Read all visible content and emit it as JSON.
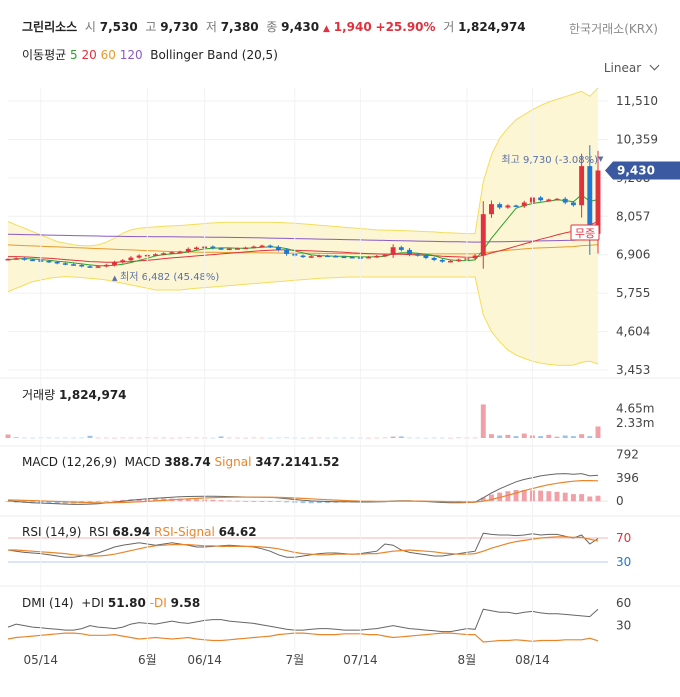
{
  "header": {
    "name": "그린리소스",
    "open_label": "시",
    "open": "7,530",
    "high_label": "고",
    "high": "9,730",
    "low_label": "저",
    "low": "7,380",
    "close_label": "종",
    "close": "9,430",
    "change_arrow": "▲",
    "change": "1,940",
    "change_pct": "+25.90%",
    "volume_label": "거",
    "volume": "1,824,974"
  },
  "exchange": "한국거래소(KRX)",
  "scale_mode": "Linear",
  "indicators": {
    "ma_label": "이동평균",
    "ma_periods": [
      "5",
      "20",
      "60",
      "120"
    ],
    "ma_colors": [
      "#2ca02c",
      "#e0313d",
      "#e89a2c",
      "#8a5ac8"
    ],
    "bollinger": "Bollinger Band (20,5)"
  },
  "colors": {
    "up": "#e0313d",
    "down": "#1f78d1",
    "band": "#f3dd5a",
    "macd": "#666666",
    "signal": "#e8862c",
    "current": "#3a59a0"
  },
  "chart_data": [
    {
      "type": "candlestick",
      "panel": "price",
      "yticks": [
        "11,510",
        "10,359",
        "9,208",
        "8,057",
        "6,906",
        "5,755",
        "4,604",
        "3,453"
      ],
      "ytick_values": [
        11510,
        10359,
        9208,
        8057,
        6906,
        5755,
        4604,
        3453
      ],
      "ylim": [
        3453,
        11900
      ],
      "x_ticks": [
        "05/14",
        "6월",
        "06/14",
        "7월",
        "07/14",
        "8월",
        "08/14"
      ],
      "x_tick_index": [
        4,
        17,
        24,
        35,
        43,
        56,
        64
      ],
      "current_price": "9,430",
      "current_value": 9430,
      "high_annotation": "최고 9,730 (-3.08%)",
      "high_value": 9730,
      "low_annotation": "최저 6,482 (45.48%)",
      "low_value": 6482,
      "event_badge": "무증",
      "close_values": [
        6780,
        6800,
        6760,
        6740,
        6720,
        6690,
        6650,
        6620,
        6600,
        6560,
        6540,
        6560,
        6600,
        6680,
        6740,
        6820,
        6880,
        6900,
        6920,
        6950,
        6980,
        7000,
        7080,
        7120,
        7150,
        7100,
        7080,
        7090,
        7100,
        7120,
        7150,
        7180,
        7140,
        7050,
        6930,
        6880,
        6840,
        6860,
        6880,
        6870,
        6850,
        6840,
        6830,
        6820,
        6840,
        6870,
        6900,
        7130,
        7050,
        6920,
        6880,
        6810,
        6750,
        6700,
        6720,
        6760,
        6800,
        6880,
        8120,
        8420,
        8320,
        8380,
        8360,
        8470,
        8620,
        8540,
        8560,
        8580,
        8470,
        8390,
        9560,
        7530,
        9430
      ],
      "ma5": [
        6760,
        6780,
        6790,
        6780,
        6760,
        6740,
        6710,
        6690,
        6660,
        6630,
        6600,
        6580,
        6570,
        6590,
        6620,
        6670,
        6740,
        6800,
        6870,
        6910,
        6930,
        6950,
        6990,
        7040,
        7080,
        7100,
        7110,
        7110,
        7100,
        7100,
        7110,
        7130,
        7140,
        7130,
        7090,
        7020,
        6960,
        6900,
        6880,
        6870,
        6860,
        6860,
        6850,
        6840,
        6840,
        6840,
        6860,
        6930,
        6960,
        6970,
        6950,
        6920,
        6880,
        6800,
        6750,
        6730,
        6730,
        6750,
        7050,
        7400,
        7700,
        8000,
        8300,
        8380,
        8440,
        8480,
        8510,
        8550,
        8530,
        8490,
        8700,
        8500,
        8560
      ],
      "ma20": [
        6850,
        6850,
        6840,
        6830,
        6810,
        6800,
        6780,
        6760,
        6740,
        6720,
        6700,
        6690,
        6680,
        6680,
        6690,
        6700,
        6720,
        6740,
        6760,
        6790,
        6810,
        6830,
        6850,
        6870,
        6890,
        6910,
        6930,
        6950,
        6970,
        6990,
        7010,
        7030,
        7040,
        7050,
        7050,
        7040,
        7030,
        7020,
        7010,
        7000,
        6990,
        6980,
        6960,
        6950,
        6940,
        6930,
        6920,
        6920,
        6920,
        6910,
        6900,
        6890,
        6880,
        6860,
        6850,
        6840,
        6830,
        6830,
        6890,
        6960,
        7020,
        7090,
        7160,
        7230,
        7300,
        7370,
        7430,
        7500,
        7560,
        7610,
        7760,
        7800,
        7900
      ],
      "ma60": [
        7200,
        7190,
        7180,
        7170,
        7160,
        7150,
        7140,
        7130,
        7120,
        7110,
        7100,
        7090,
        7080,
        7070,
        7060,
        7050,
        7040,
        7030,
        7020,
        7010,
        7000,
        6995,
        6990,
        6985,
        6980,
        6978,
        6975,
        6972,
        6970,
        6968,
        6965,
        6962,
        6960,
        6958,
        6955,
        6952,
        6950,
        6948,
        6946,
        6944,
        6942,
        6940,
        6938,
        6936,
        6934,
        6932,
        6930,
        6930,
        6930,
        6930,
        6930,
        6930,
        6930,
        6930,
        6930,
        6930,
        6930,
        6930,
        6960,
        6990,
        7020,
        7040,
        7060,
        7080,
        7100,
        7110,
        7120,
        7130,
        7140,
        7150,
        7180,
        7190,
        7210
      ],
      "ma120": [
        7520,
        7515,
        7510,
        7505,
        7500,
        7495,
        7490,
        7485,
        7480,
        7475,
        7470,
        7466,
        7462,
        7458,
        7455,
        7452,
        7450,
        7448,
        7446,
        7444,
        7442,
        7440,
        7438,
        7436,
        7434,
        7432,
        7430,
        7426,
        7422,
        7418,
        7414,
        7410,
        7405,
        7400,
        7395,
        7390,
        7385,
        7380,
        7375,
        7370,
        7365,
        7360,
        7355,
        7350,
        7345,
        7340,
        7335,
        7330,
        7325,
        7320,
        7315,
        7310,
        7305,
        7300,
        7296,
        7292,
        7288,
        7284,
        7288,
        7292,
        7296,
        7300,
        7305,
        7310,
        7315,
        7320,
        7325,
        7330,
        7335,
        7340,
        7355,
        7360,
        7370
      ],
      "bb_upper": [
        7900,
        7800,
        7700,
        7600,
        7500,
        7400,
        7300,
        7250,
        7200,
        7180,
        7170,
        7200,
        7280,
        7400,
        7550,
        7650,
        7700,
        7720,
        7740,
        7760,
        7770,
        7780,
        7800,
        7820,
        7840,
        7860,
        7870,
        7880,
        7880,
        7880,
        7880,
        7880,
        7880,
        7870,
        7860,
        7850,
        7830,
        7810,
        7790,
        7770,
        7750,
        7730,
        7710,
        7690,
        7670,
        7650,
        7640,
        7640,
        7630,
        7620,
        7610,
        7600,
        7590,
        7570,
        7560,
        7550,
        7540,
        7540,
        9100,
        9900,
        10400,
        10700,
        10950,
        11100,
        11250,
        11380,
        11480,
        11560,
        11640,
        11720,
        11800,
        11650,
        11900
      ],
      "bb_lower": [
        5800,
        5900,
        6000,
        6100,
        6150,
        6200,
        6230,
        6250,
        6240,
        6220,
        6200,
        6180,
        6150,
        6100,
        6050,
        6000,
        5950,
        5900,
        5850,
        5850,
        5850,
        5850,
        5880,
        5900,
        5920,
        5940,
        5960,
        5980,
        6000,
        6020,
        6040,
        6060,
        6080,
        6100,
        6120,
        6140,
        6160,
        6180,
        6200,
        6210,
        6220,
        6230,
        6240,
        6240,
        6240,
        6240,
        6240,
        6240,
        6240,
        6240,
        6240,
        6240,
        6240,
        6240,
        6240,
        6240,
        6240,
        6240,
        5100,
        4600,
        4300,
        4050,
        3900,
        3800,
        3720,
        3660,
        3620,
        3600,
        3590,
        3600,
        3680,
        3720,
        3630
      ]
    },
    {
      "type": "bar",
      "panel": "volume",
      "title": "거래량",
      "value_label": "1,824,974",
      "yticks": [
        "4.65m",
        "2.33m"
      ],
      "ytick_values": [
        4.65,
        2.33
      ],
      "ylim": [
        0,
        6.0
      ],
      "values": [
        0.55,
        0.12,
        0.05,
        0.04,
        0.06,
        0.05,
        0.04,
        0.05,
        0.04,
        0.05,
        0.35,
        0.04,
        0.04,
        0.03,
        0.05,
        0.04,
        0.04,
        0.06,
        0.04,
        0.05,
        0.03,
        0.04,
        0.06,
        0.05,
        0.04,
        0.03,
        0.25,
        0.05,
        0.04,
        0.03,
        0.05,
        0.04,
        0.03,
        0.05,
        0.06,
        0.04,
        0.03,
        0.04,
        0.05,
        0.03,
        0.04,
        0.04,
        0.05,
        0.04,
        0.03,
        0.04,
        0.05,
        0.22,
        0.25,
        0.05,
        0.04,
        0.03,
        0.05,
        0.04,
        0.03,
        0.06,
        0.04,
        0.05,
        5.3,
        0.6,
        0.4,
        0.5,
        0.3,
        0.7,
        0.4,
        0.3,
        0.5,
        0.2,
        0.4,
        0.3,
        0.6,
        0.3,
        1.82
      ]
    },
    {
      "type": "line",
      "panel": "macd",
      "title": "MACD (12,26,9)",
      "macd_label": "MACD",
      "macd_value": "388.74",
      "signal_label": "Signal",
      "signal_value": "347.2141.52",
      "yticks": [
        "792",
        "396",
        "0"
      ],
      "ytick_values": [
        792,
        396,
        0
      ],
      "ylim": [
        -150,
        820
      ],
      "macd": [
        10,
        -5,
        -15,
        -25,
        -32,
        -38,
        -45,
        -50,
        -55,
        -55,
        -50,
        -42,
        -30,
        -15,
        0,
        15,
        28,
        40,
        50,
        60,
        68,
        75,
        80,
        82,
        84,
        84,
        82,
        78,
        75,
        72,
        70,
        68,
        64,
        56,
        42,
        28,
        15,
        5,
        0,
        -5,
        -8,
        -10,
        -12,
        -14,
        -14,
        -12,
        -8,
        4,
        8,
        6,
        2,
        -6,
        -14,
        -22,
        -26,
        -26,
        -24,
        -18,
        60,
        140,
        210,
        270,
        330,
        370,
        400,
        430,
        450,
        465,
        470,
        460,
        470,
        430,
        440
      ],
      "signal": [
        20,
        18,
        14,
        10,
        5,
        0,
        -5,
        -10,
        -15,
        -20,
        -24,
        -27,
        -28,
        -26,
        -22,
        -17,
        -10,
        -3,
        5,
        14,
        24,
        32,
        40,
        48,
        55,
        60,
        64,
        66,
        68,
        68,
        68,
        68,
        67,
        65,
        61,
        55,
        48,
        40,
        32,
        25,
        18,
        12,
        7,
        2,
        -1,
        -3,
        -4,
        -2,
        0,
        1,
        1,
        -1,
        -3,
        -6,
        -10,
        -13,
        -15,
        -16,
        -1,
        28,
        64,
        100,
        140,
        180,
        215,
        250,
        280,
        305,
        325,
        340,
        350,
        350,
        347
      ]
    },
    {
      "type": "line",
      "panel": "rsi",
      "title": "RSI (14,9)",
      "rsi_label": "RSI",
      "rsi_value": "68.94",
      "signal_label": "RSI-Signal",
      "signal_value": "64.62",
      "yticks": [
        "70",
        "30"
      ],
      "ytick_values": [
        70,
        30
      ],
      "ylim": [
        0,
        100
      ],
      "rsi": [
        50,
        48,
        46,
        45,
        44,
        42,
        40,
        38,
        38,
        40,
        42,
        45,
        50,
        55,
        58,
        60,
        62,
        60,
        58,
        60,
        62,
        60,
        58,
        55,
        55,
        56,
        57,
        58,
        57,
        56,
        55,
        52,
        48,
        42,
        38,
        38,
        40,
        42,
        44,
        45,
        45,
        44,
        43,
        44,
        46,
        48,
        60,
        58,
        50,
        46,
        44,
        42,
        40,
        40,
        42,
        44,
        46,
        48,
        78,
        76,
        75,
        75,
        74,
        75,
        77,
        75,
        76,
        76,
        73,
        70,
        75,
        60,
        69
      ],
      "signal": [
        50,
        50,
        49,
        48,
        47,
        46,
        45,
        44,
        42,
        41,
        40,
        40,
        41,
        43,
        46,
        49,
        52,
        55,
        57,
        58,
        59,
        59,
        59,
        58,
        57,
        57,
        56,
        56,
        56,
        56,
        56,
        55,
        54,
        52,
        49,
        46,
        44,
        43,
        42,
        42,
        43,
        43,
        43,
        43,
        44,
        44,
        46,
        48,
        49,
        50,
        49,
        48,
        47,
        45,
        44,
        43,
        43,
        44,
        48,
        53,
        57,
        61,
        64,
        66,
        68,
        70,
        71,
        72,
        72,
        71,
        71,
        68,
        65
      ]
    },
    {
      "type": "line",
      "panel": "dmi",
      "title": "DMI (14)",
      "pdi_label": "+DI",
      "pdi_value": "51.80",
      "mdi_label": "-DI",
      "mdi_value": "9.58",
      "yticks": [
        "60",
        "30"
      ],
      "ytick_values": [
        60,
        30
      ],
      "ylim": [
        0,
        75
      ],
      "pdi": [
        28,
        32,
        30,
        28,
        27,
        26,
        25,
        24,
        24,
        26,
        30,
        28,
        27,
        26,
        28,
        32,
        34,
        33,
        32,
        34,
        36,
        34,
        33,
        35,
        37,
        38,
        38,
        36,
        35,
        34,
        33,
        31,
        29,
        27,
        25,
        24,
        24,
        25,
        26,
        26,
        25,
        24,
        24,
        24,
        25,
        26,
        28,
        30,
        28,
        26,
        25,
        24,
        23,
        22,
        22,
        24,
        26,
        25,
        52,
        50,
        48,
        48,
        46,
        48,
        49,
        47,
        46,
        46,
        45,
        44,
        43,
        42,
        52
      ],
      "mdi": [
        12,
        14,
        15,
        16,
        17,
        18,
        19,
        20,
        20,
        19,
        17,
        17,
        17,
        18,
        16,
        14,
        12,
        13,
        14,
        13,
        12,
        13,
        14,
        12,
        11,
        10,
        10,
        11,
        12,
        13,
        14,
        15,
        16,
        18,
        19,
        20,
        20,
        19,
        18,
        18,
        18,
        19,
        19,
        19,
        18,
        18,
        16,
        14,
        15,
        16,
        17,
        18,
        19,
        20,
        20,
        19,
        18,
        18,
        8,
        9,
        10,
        10,
        11,
        10,
        9,
        10,
        10,
        10,
        11,
        11,
        11,
        13,
        9.6
      ]
    }
  ]
}
